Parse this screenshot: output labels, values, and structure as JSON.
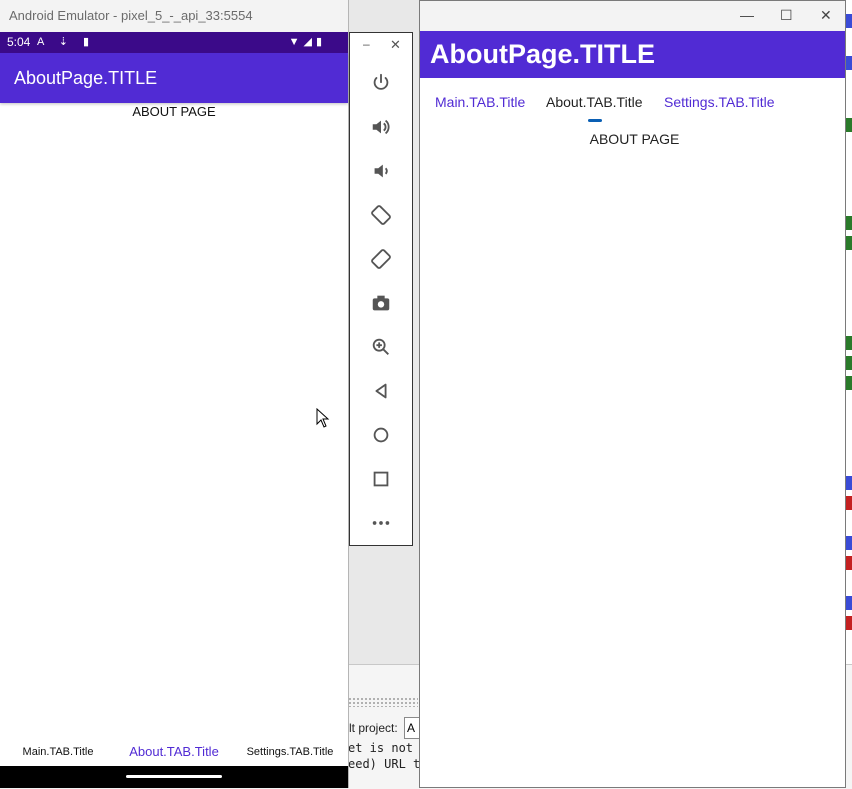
{
  "emulator": {
    "window_title": "Android Emulator - pixel_5_-_api_33:5554",
    "status_time": "5:04",
    "status_icons_left": "A ⇣ ▮",
    "status_icons_right": "▼◢▮",
    "app_title": "AboutPage.TITLE",
    "content_text": "ABOUT PAGE",
    "bottom_tabs": [
      {
        "label": "Main.TAB.Title",
        "active": false
      },
      {
        "label": "About.TAB.Title",
        "active": true
      },
      {
        "label": "Settings.TAB.Title",
        "active": false
      }
    ],
    "accent_color": "#512bd4",
    "status_color": "#3b0a89"
  },
  "toolbar": {
    "minimize": "–",
    "close": "✕",
    "tools": [
      {
        "name": "power-icon"
      },
      {
        "name": "volume-up-icon"
      },
      {
        "name": "volume-down-icon"
      },
      {
        "name": "rotate-left-icon"
      },
      {
        "name": "rotate-right-icon"
      },
      {
        "name": "camera-icon"
      },
      {
        "name": "zoom-icon"
      },
      {
        "name": "back-icon"
      },
      {
        "name": "home-icon"
      },
      {
        "name": "overview-icon"
      },
      {
        "name": "more-icon"
      }
    ]
  },
  "desktop": {
    "window_controls": {
      "minimize": "—",
      "maximize": "☐",
      "close": "✕"
    },
    "header_title": "AboutPage.TITLE",
    "tabs": [
      {
        "label": "Main.TAB.Title",
        "active": false
      },
      {
        "label": "About.TAB.Title",
        "active": true
      },
      {
        "label": "Settings.TAB.Title",
        "active": false
      }
    ],
    "content_text": "ABOUT PAGE"
  },
  "ide": {
    "project_label": "lt project:",
    "project_value": "A",
    "log_line_1": "et is not r",
    "log_line_2": "eed) URL to"
  }
}
